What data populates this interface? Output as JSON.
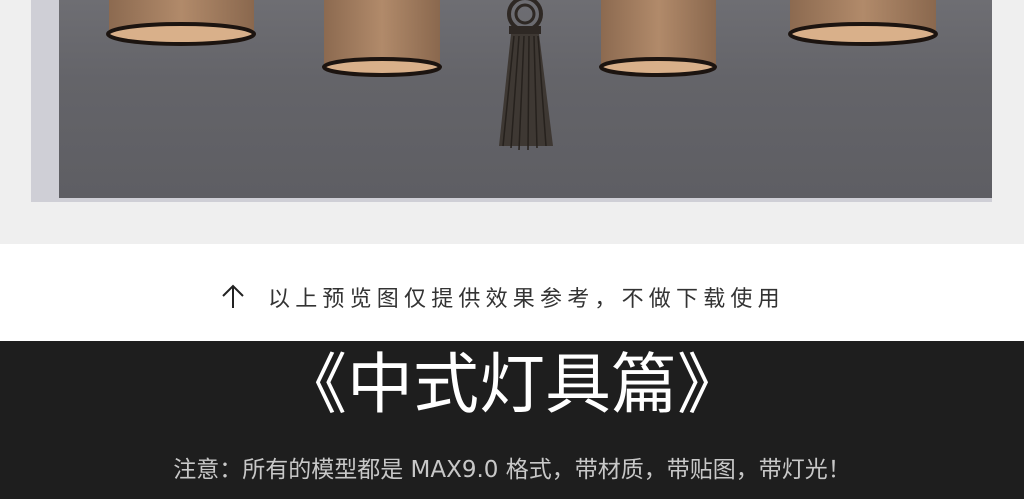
{
  "preview": {
    "image_subject": "chinese-lamp-render-preview",
    "colors": {
      "background": "#646469",
      "shade": "#a67e60",
      "rim": "#1c1410",
      "tassel": "#3e3833"
    }
  },
  "notice": {
    "arrow_icon": "arrow-up-icon",
    "text": "以上预览图仅提供效果参考，不做下载使用"
  },
  "banner": {
    "title": "《中式灯具篇》",
    "subtitle": "注意：所有的模型都是 MAX9.0 格式，带材质，带贴图，带灯光！",
    "colors": {
      "background": "#1e1e1e",
      "title": "#ffffff",
      "subtitle": "#c8c8c8"
    }
  }
}
